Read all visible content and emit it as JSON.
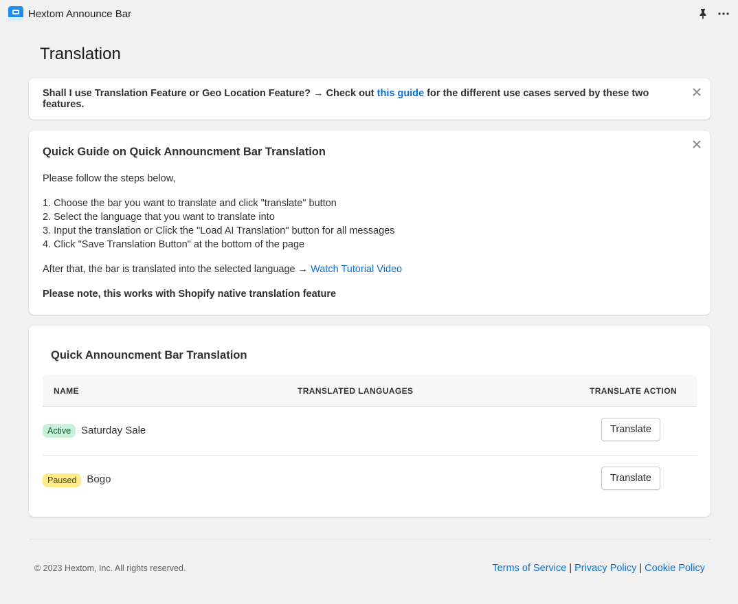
{
  "app": {
    "name": "Hextom Announce Bar",
    "logo_icon": "announce-bar-logo",
    "pin_icon": "pin-icon",
    "more_icon": "more-horizontal-icon"
  },
  "page": {
    "title": "Translation"
  },
  "banner": {
    "text_before": "Shall I use Translation Feature or Geo Location Feature? → Check out ",
    "link_text": "this guide",
    "text_after": " for the different use cases served by these two features."
  },
  "guide": {
    "title": "Quick Guide on Quick Announcment Bar Translation",
    "intro": "Please follow the steps below,",
    "steps": [
      "1. Choose the bar you want to translate and click \"translate\" button",
      "2. Select the language that you want to translate into",
      "3. Input the translation or Click the \"Load AI Translation\" button for all messages",
      "4. Click \"Save Translation Button\" at the bottom of the page"
    ],
    "after_text": "After that, the bar is translated into the selected language → ",
    "video_link": "Watch Tutorial Video",
    "note": "Please note, this works with Shopify native translation feature"
  },
  "table": {
    "title": "Quick Announcment Bar Translation",
    "columns": [
      "NAME",
      "TRANSLATED LANGUAGES",
      "TRANSLATE ACTION"
    ],
    "rows": [
      {
        "status": "Active",
        "name": "Saturday Sale",
        "action": "Translate"
      },
      {
        "status": "Paused",
        "name": "Bogo",
        "action": "Translate"
      }
    ]
  },
  "footer": {
    "copyright": "© 2023 Hextom, Inc. All rights reserved.",
    "links": [
      "Terms of Service",
      "Privacy Policy",
      "Cookie Policy"
    ],
    "separator": "|"
  },
  "colors": {
    "link": "#0a6fd6",
    "active_badge": "#c8f2d7",
    "paused_badge": "#ffeb8a",
    "logo": "#1e8ef5"
  }
}
